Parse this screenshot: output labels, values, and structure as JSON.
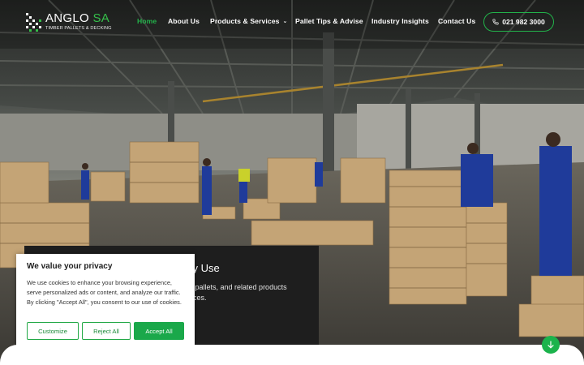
{
  "brand": {
    "name_main": "ANGLO",
    "name_accent": "SA",
    "tagline": "TIMBER PALLETS & DECKING",
    "accent_color": "#22b34a"
  },
  "nav": {
    "items": [
      {
        "label": "Home",
        "active": true
      },
      {
        "label": "About Us",
        "active": false
      },
      {
        "label": "Products & Services",
        "active": false,
        "has_dropdown": true
      },
      {
        "label": "Pallet Tips & Advise",
        "active": false
      },
      {
        "label": "Industry Insights",
        "active": false
      },
      {
        "label": "Contact Us",
        "active": false
      }
    ],
    "dropdown_icon": "chevron-down-icon"
  },
  "header": {
    "phone": "021 982 3000",
    "phone_icon": "phone-icon"
  },
  "hero": {
    "heading_visible": "day Use",
    "text_line1": "u pallets, and related products",
    "text_line2": "rices."
  },
  "cookie": {
    "title": "We value your privacy",
    "text": "We use cookies to enhance your browsing experience, serve personalized ads or content, and analyze our traffic. By clicking \"Accept All\", you consent to our use of cookies.",
    "customize": "Customize",
    "reject": "Reject All",
    "accept": "Accept All"
  },
  "scroll_button": {
    "icon": "arrow-down-icon"
  }
}
